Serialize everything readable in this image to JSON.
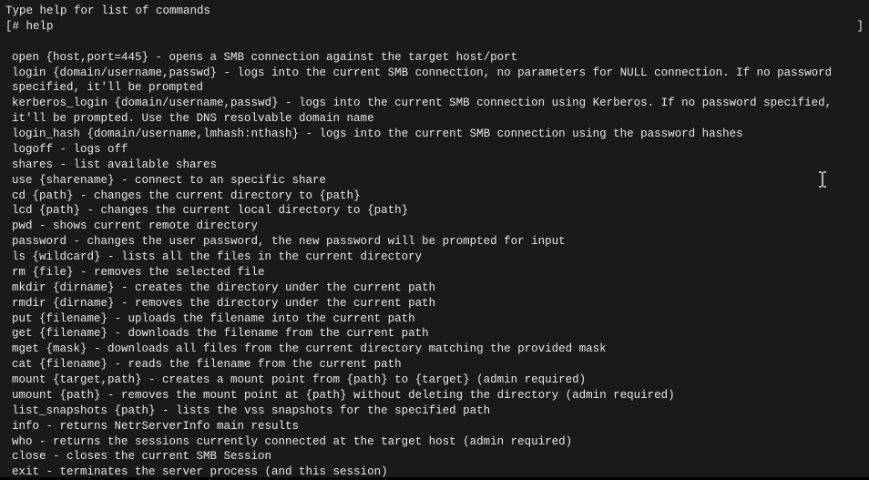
{
  "header": "Type help for list of commands",
  "prompt_left": "[# help",
  "prompt_right": "]",
  "commands": [
    "open {host,port=445} - opens a SMB connection against the target host/port",
    "login {domain/username,passwd} - logs into the current SMB connection, no parameters for NULL connection. If no password specified, it'll be prompted",
    "kerberos_login {domain/username,passwd} - logs into the current SMB connection using Kerberos. If no password specified, it'll be prompted. Use the DNS resolvable domain name",
    "login_hash {domain/username,lmhash:nthash} - logs into the current SMB connection using the password hashes",
    "logoff - logs off",
    "shares - list available shares",
    "use {sharename} - connect to an specific share",
    "cd {path} - changes the current directory to {path}",
    "lcd {path} - changes the current local directory to {path}",
    "pwd - shows current remote directory",
    "password - changes the user password, the new password will be prompted for input",
    "ls {wildcard} - lists all the files in the current directory",
    "rm {file} - removes the selected file",
    "mkdir {dirname} - creates the directory under the current path",
    "rmdir {dirname} - removes the directory under the current path",
    "put {filename} - uploads the filename into the current path",
    "get {filename} - downloads the filename from the current path",
    "mget {mask} - downloads all files from the current directory matching the provided mask",
    "cat {filename} - reads the filename from the current path",
    "mount {target,path} - creates a mount point from {path} to {target} (admin required)",
    "umount {path} - removes the mount point at {path} without deleting the directory (admin required)",
    "list_snapshots {path} - lists the vss snapshots for the specified path",
    "info - returns NetrServerInfo main results",
    "who - returns the sessions currently connected at the target host (admin required)",
    "close - closes the current SMB Session",
    "exit - terminates the server process (and this session)"
  ]
}
